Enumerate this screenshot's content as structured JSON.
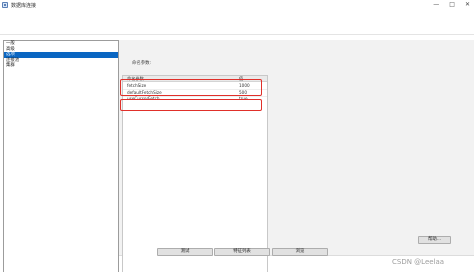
{
  "window": {
    "title": "数据库连接",
    "controls": [
      "—",
      "□",
      "✕"
    ]
  },
  "sidebar": {
    "items": [
      {
        "label": "一般",
        "selected": false
      },
      {
        "label": "高级",
        "selected": false
      },
      {
        "label": "选项",
        "selected": true
      },
      {
        "label": "连接池",
        "selected": false
      },
      {
        "label": "集群",
        "selected": false
      }
    ]
  },
  "options": {
    "section_label": "命名参数:",
    "columns": {
      "name": "命名参数",
      "value": "值"
    },
    "rows": [
      {
        "name": "fetchSize",
        "value": "1000"
      },
      {
        "name": "defaultFetchSize",
        "value": "500"
      },
      {
        "name": "useCursorFetch",
        "value": "true"
      }
    ],
    "more_button": "帮助..."
  },
  "footer": {
    "test_button": "测试",
    "driver_button": "特征列表",
    "browse_button": "浏览"
  },
  "watermark": "CSDN @Leelaa",
  "colors": {
    "selection": "#0a66c2",
    "highlight_box": "#e0302a",
    "panel_bg": "#f2f2f2"
  }
}
